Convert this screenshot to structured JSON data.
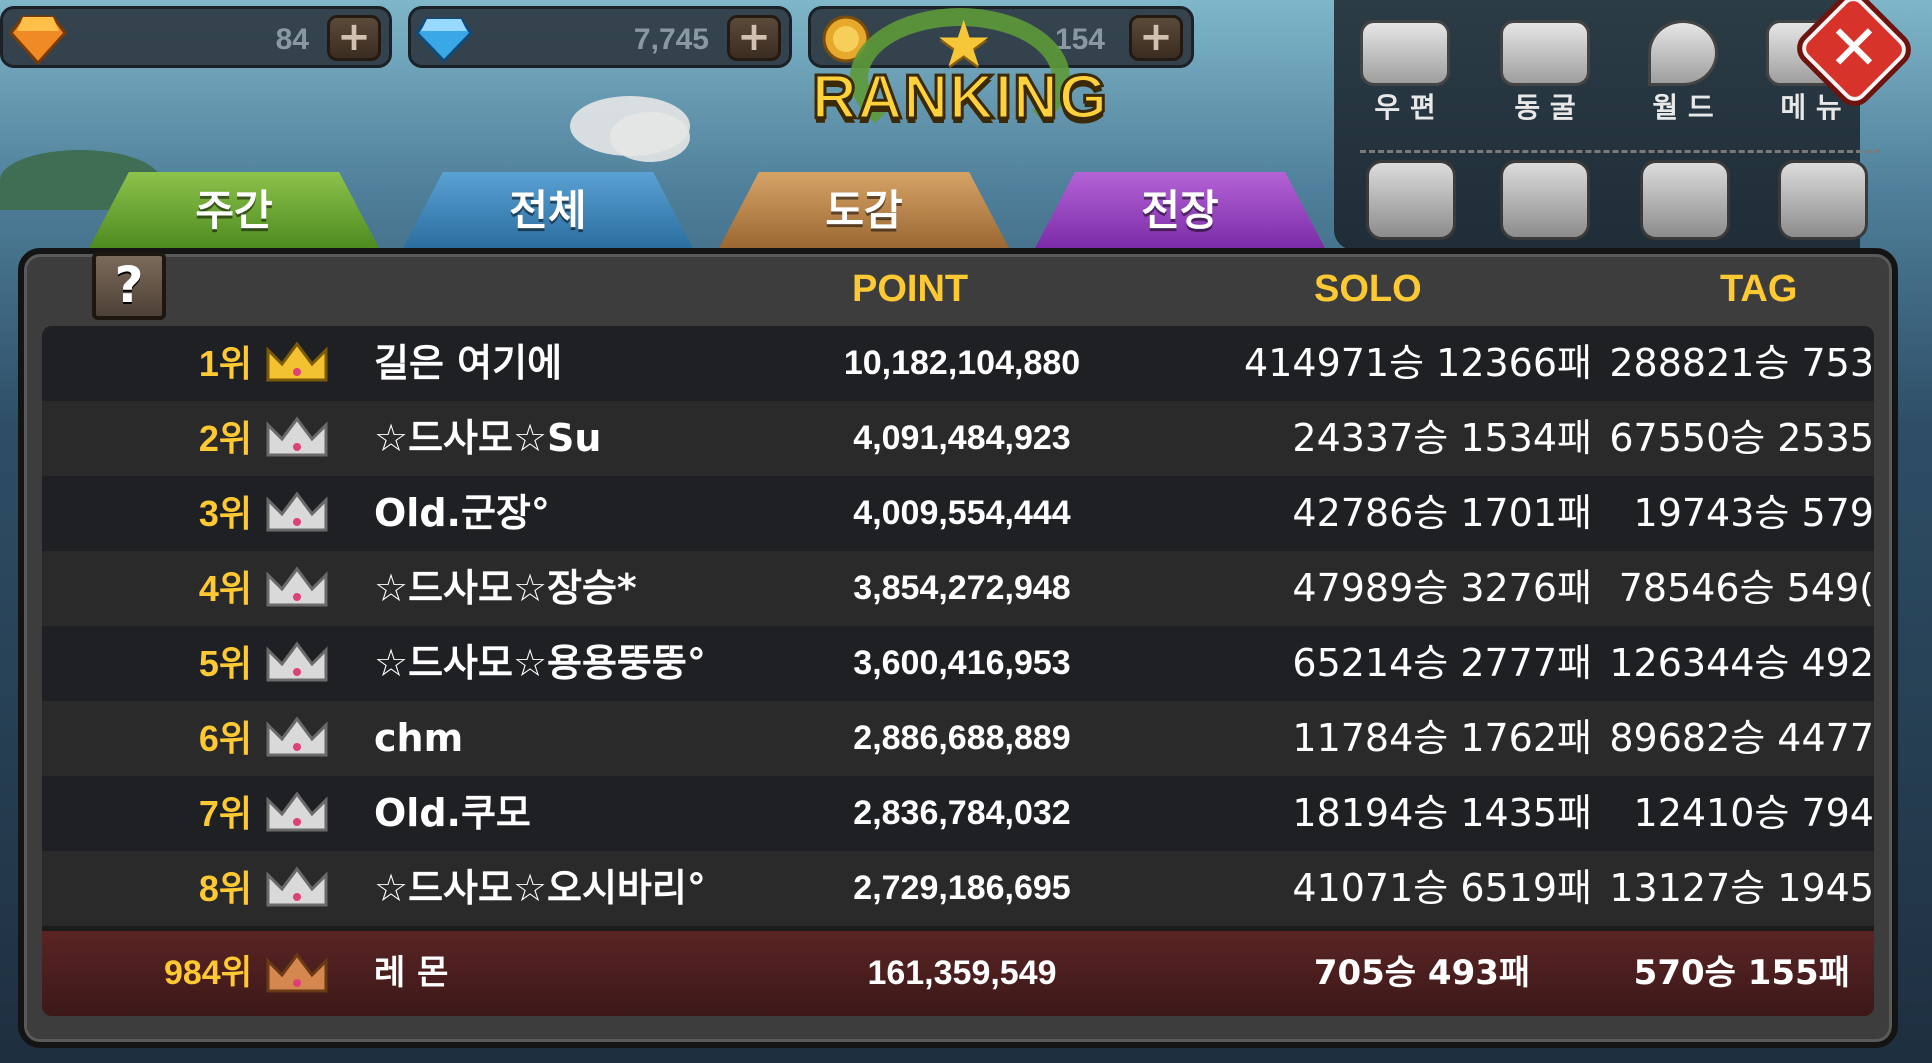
{
  "currency": {
    "orange_gem": {
      "value": "84",
      "icon": "orange-gem-icon"
    },
    "blue_gem": {
      "value": "7,745",
      "icon": "blue-diamond-icon"
    },
    "coin": {
      "value": "154",
      "icon": "coin-icon"
    },
    "plus_label": "+"
  },
  "logo": {
    "title": "RANKING"
  },
  "menu": {
    "items": [
      {
        "label": "우 편",
        "icon": "mail-icon"
      },
      {
        "label": "동 굴",
        "icon": "cave-icon"
      },
      {
        "label": "월 드",
        "icon": "world-pin-icon"
      },
      {
        "label": "메 뉴",
        "icon": "menu-icon"
      }
    ],
    "close_label": "✕"
  },
  "tabs": [
    {
      "label": "주간",
      "color": "#4c8a1f"
    },
    {
      "label": "전체",
      "color": "#2a6c9e"
    },
    {
      "label": "도감",
      "color": "#9a6631"
    },
    {
      "label": "전장",
      "color": "#7a2aa6"
    }
  ],
  "help_label": "?",
  "columns": {
    "point": "POINT",
    "solo": "SOLO",
    "tag": "TAG"
  },
  "rows": [
    {
      "rank": "1위",
      "crown": "gold",
      "name": "길은 여기에",
      "point": "10,182,104,880",
      "solo": "414971승 12366패",
      "tag": "288821승 753"
    },
    {
      "rank": "2위",
      "crown": "silver",
      "name": "☆드사모☆Su",
      "point": "4,091,484,923",
      "solo": "24337승 1534패",
      "tag": "67550승 2535"
    },
    {
      "rank": "3위",
      "crown": "silver",
      "name": "Old.군장°",
      "point": "4,009,554,444",
      "solo": "42786승 1701패",
      "tag": "19743승 579"
    },
    {
      "rank": "4위",
      "crown": "silver",
      "name": "☆드사모☆장승*",
      "point": "3,854,272,948",
      "solo": "47989승 3276패",
      "tag": "78546승 549("
    },
    {
      "rank": "5위",
      "crown": "silver",
      "name": "☆드사모☆용용뚱뚱°",
      "point": "3,600,416,953",
      "solo": "65214승 2777패",
      "tag": "126344승 492"
    },
    {
      "rank": "6위",
      "crown": "silver",
      "name": "chm",
      "point": "2,886,688,889",
      "solo": "11784승 1762패",
      "tag": "89682승 4477"
    },
    {
      "rank": "7위",
      "crown": "silver",
      "name": "Old.쿠모",
      "point": "2,836,784,032",
      "solo": "18194승 1435패",
      "tag": "12410승 794"
    },
    {
      "rank": "8위",
      "crown": "silver",
      "name": "☆드사모☆오시바리°",
      "point": "2,729,186,695",
      "solo": "41071승 6519패",
      "tag": "13127승 1945"
    }
  ],
  "my_row": {
    "rank": "984위",
    "crown": "bronze",
    "name": "레 몬",
    "point": "161,359,549",
    "solo": "705승 493패",
    "tag": "570승 155패"
  },
  "crown_colors": {
    "gold": "#f2c230",
    "silver": "#d9d9d9",
    "bronze": "#d4874e"
  }
}
